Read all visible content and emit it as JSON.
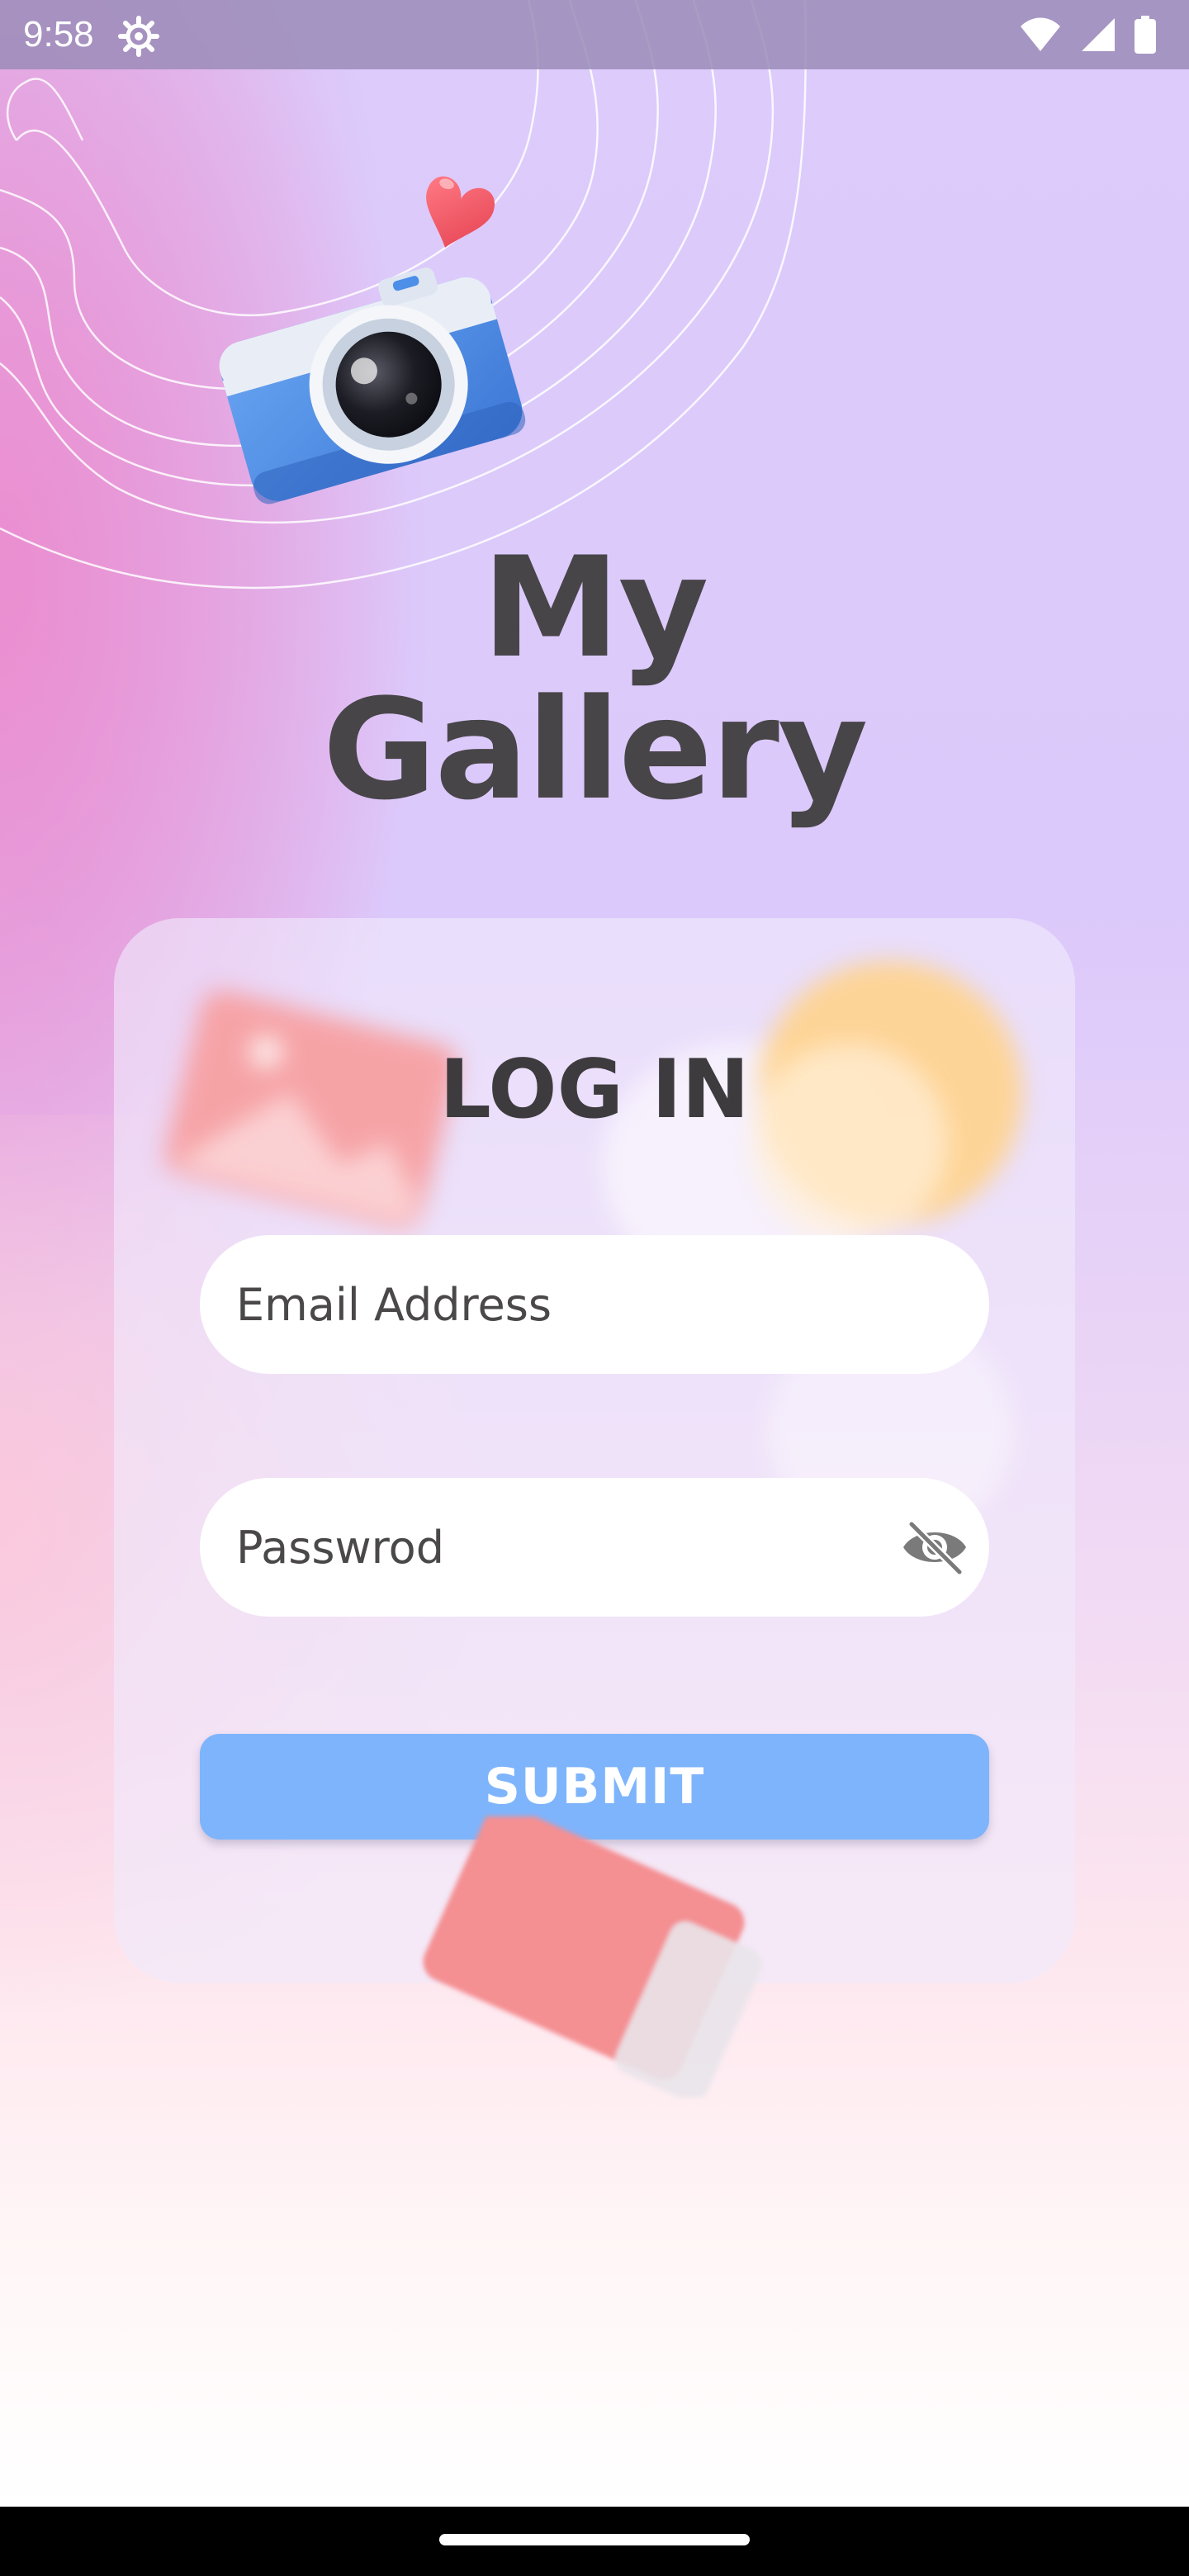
{
  "status_bar": {
    "time": "9:58",
    "icons": [
      "settings-gear-icon",
      "wifi-icon",
      "signal-icon",
      "battery-icon"
    ]
  },
  "app": {
    "title_line1": "My",
    "title_line2": "Gallery"
  },
  "login": {
    "heading": "LOG IN",
    "email_placeholder": "Email Address",
    "password_placeholder": "Passwrod",
    "password_toggle_icon": "eye-off-icon",
    "submit_label": "SUBMIT"
  },
  "colors": {
    "accent_button": "#7eb4fc",
    "title_text": "#474548",
    "background_lavender": "#dccbfb",
    "background_pink": "#ec8ccd",
    "heart": "#ef5a67"
  }
}
